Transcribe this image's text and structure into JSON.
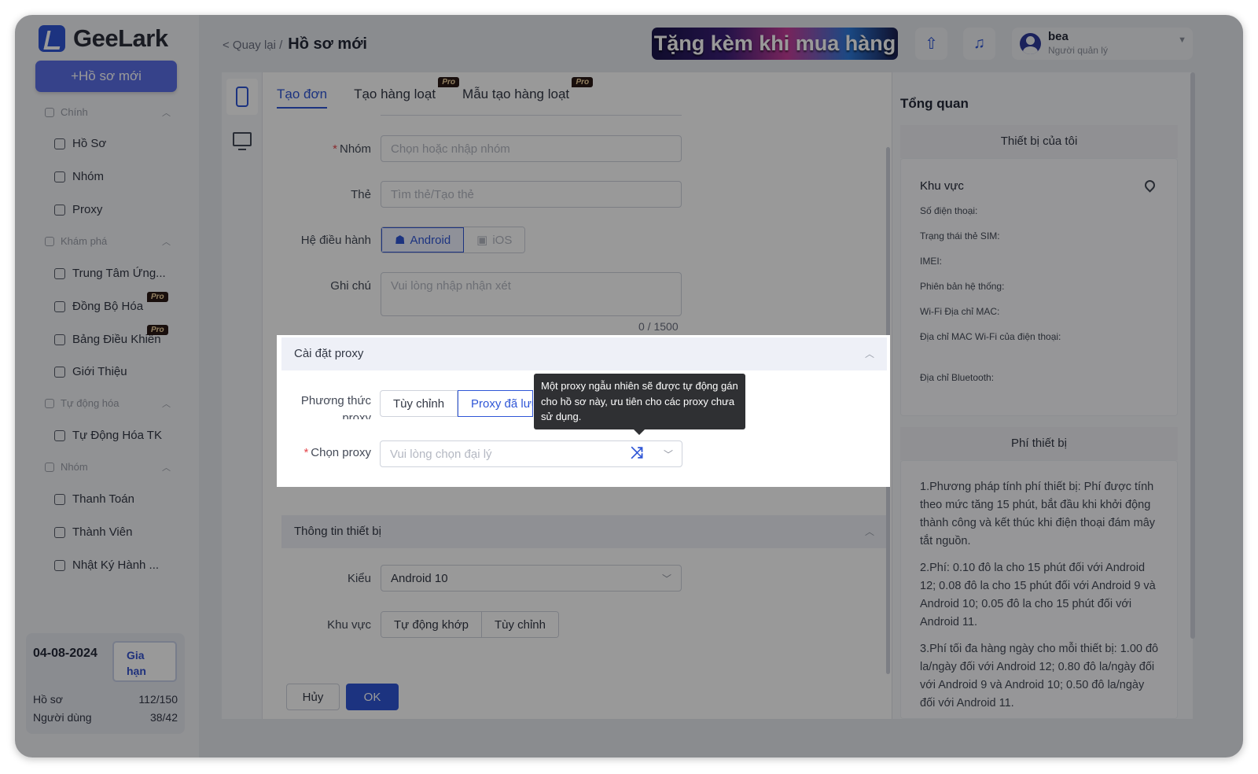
{
  "brand": {
    "name": "GeeLark"
  },
  "sidebar": {
    "new_profile": "+Hồ sơ mới",
    "sections": [
      {
        "label": "Chính",
        "items": [
          "Hồ Sơ",
          "Nhóm",
          "Proxy"
        ]
      },
      {
        "label": "Khám phá",
        "items": [
          "Trung Tâm Ứng...",
          "Đồng Bộ Hóa",
          "Bảng Điều Khiển",
          "Giới Thiệu"
        ]
      },
      {
        "label": "Tự động hóa",
        "items": [
          "Tự Động Hóa TK"
        ]
      },
      {
        "label": "Nhóm",
        "items": [
          "Thanh Toán",
          "Thành Viên",
          "Nhật Ký Hành ..."
        ]
      }
    ],
    "pro": "Pro",
    "subscription": {
      "date": "04-08-2024",
      "renew": "Gia hạn",
      "profiles_label": "Hồ sơ",
      "profiles_value": "112/150",
      "users_label": "Người dùng",
      "users_value": "38/42"
    }
  },
  "header": {
    "back": "< Quay lại /",
    "title": "Hồ sơ mới",
    "promo": "Tặng kèm khi mua hàng",
    "user": {
      "name": "bea",
      "role": "Người quản lý"
    }
  },
  "tabs": [
    "Tạo đơn",
    "Tạo hàng loạt",
    "Mẫu tạo hàng loạt"
  ],
  "form": {
    "group_label": "Nhóm",
    "group_placeholder": "Chọn hoặc nhập nhóm",
    "tag_label": "Thẻ",
    "tag_placeholder": "Tìm thẻ/Tạo thẻ",
    "os_label": "Hệ điều hành",
    "os_options": [
      "Android",
      "iOS"
    ],
    "note_label": "Ghi chú",
    "note_placeholder": "Vui lòng nhập nhận xét",
    "note_counter": "0 / 1500"
  },
  "proxy": {
    "section": "Cài đặt proxy",
    "method_label": "Phương thức proxy",
    "method_options": [
      "Tùy chỉnh",
      "Proxy đã lưu"
    ],
    "choose_label": "Chọn proxy",
    "choose_placeholder": "Vui lòng chọn đại lý",
    "tooltip": "Một proxy ngẫu nhiên sẽ được tự động gán cho hồ sơ này, ưu tiên cho các proxy chưa sử dụng."
  },
  "device": {
    "section": "Thông tin thiết bị",
    "type_label": "Kiểu",
    "type_value": "Android 10",
    "region_label": "Khu vực",
    "region_options": [
      "Tự động khớp",
      "Tùy chỉnh"
    ]
  },
  "actions": {
    "cancel": "Hủy",
    "ok": "OK"
  },
  "overview": {
    "title": "Tổng quan",
    "my_device": "Thiết bị của tôi",
    "region": "Khu vực",
    "fields": [
      "Số điện thoại:",
      "Trạng thái thẻ SIM:",
      "IMEI:",
      "Phiên bản hệ thống:",
      "Wi-Fi Địa chỉ MAC:",
      "Địa chỉ MAC Wi-Fi của điện thoại:",
      "Địa chỉ Bluetooth:"
    ],
    "fee_title": "Phí thiết bị",
    "fee_paragraphs": [
      "1.Phương pháp tính phí thiết bị: Phí được tính theo mức tăng 15 phút, bắt đầu khi khởi động thành công và kết thúc khi điện thoại đám mây tắt nguồn.",
      "2.Phí: 0.10 đô la cho 15 phút đối với Android 12; 0.08 đô la cho 15 phút đối với Android 9 và Android 10; 0.05 đô la cho 15 phút đối với Android 11.",
      "3.Phí tối đa hàng ngày cho mỗi thiết bị: 1.00 đô la/ngày đối với Android 12; 0.80 đô la/ngày đối với Android 9 và Android 10; 0.50 đô la/ngày đối với Android 11."
    ]
  }
}
